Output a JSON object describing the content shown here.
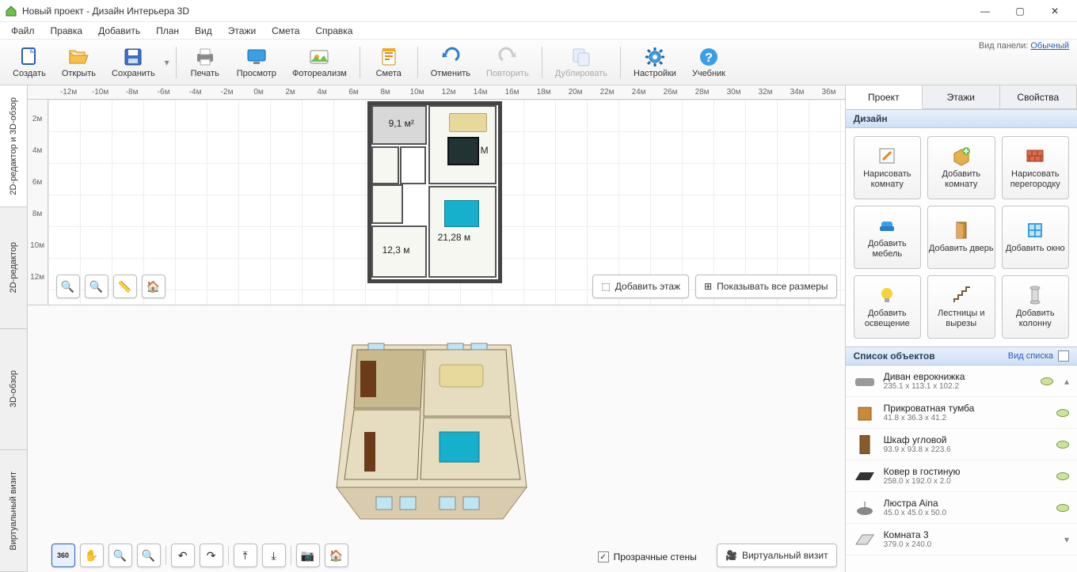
{
  "app": {
    "title": "Новый проект - Дизайн Интерьера 3D"
  },
  "window_controls": {
    "min": "—",
    "max": "▢",
    "close": "✕"
  },
  "menubar": [
    "Файл",
    "Правка",
    "Добавить",
    "План",
    "Вид",
    "Этажи",
    "Смета",
    "Справка"
  ],
  "toolbar": {
    "create": "Создать",
    "open": "Открыть",
    "save": "Сохранить",
    "print": "Печать",
    "preview": "Просмотр",
    "photoreal": "Фотореализм",
    "estimate": "Смета",
    "undo": "Отменить",
    "redo": "Повторить",
    "duplicate": "Дублировать",
    "settings": "Настройки",
    "tutorial": "Учебник"
  },
  "panel_mode": {
    "label": "Вид панели:",
    "value": "Обычный"
  },
  "left_tabs": {
    "combo": "2D-редактор и 3D-обзор",
    "editor2d": "2D-редактор",
    "view3d": "3D-обзор",
    "vr": "Виртуальный визит"
  },
  "ruler_h": [
    "-12м",
    "-10м",
    "-8м",
    "-6м",
    "-4м",
    "-2м",
    "0м",
    "2м",
    "4м",
    "6м",
    "8м",
    "10м",
    "12м",
    "14м",
    "16м",
    "18м",
    "20м",
    "22м",
    "24м",
    "26м",
    "28м",
    "30м",
    "32м",
    "34м",
    "36м"
  ],
  "ruler_v": [
    "2м",
    "4м",
    "6м",
    "8м",
    "10м",
    "12м"
  ],
  "plan": {
    "room_a": "9,1 м²",
    "room_b": "12,3 м",
    "room_c": "21,28 м",
    "mark_m": "М"
  },
  "btns2d": {
    "add_floor": "Добавить этаж",
    "show_dims": "Показывать все размеры"
  },
  "btns3d": {
    "transparent": "Прозрачные стены",
    "vr": "Виртуальный визит"
  },
  "right_tabs": {
    "project": "Проект",
    "floors": "Этажи",
    "props": "Свойства"
  },
  "design": {
    "header": "Дизайн",
    "draw_room": "Нарисовать комнату",
    "add_room": "Добавить комнату",
    "draw_wall": "Нарисовать перегородку",
    "add_furn": "Добавить мебель",
    "add_door": "Добавить дверь",
    "add_window": "Добавить окно",
    "add_light": "Добавить освещение",
    "stairs": "Лестницы и вырезы",
    "add_column": "Добавить колонну"
  },
  "objects": {
    "header": "Список объектов",
    "view_mode": "Вид списка",
    "items": [
      {
        "name": "Диван еврокнижка",
        "dims": "235.1 x 113.1 x 102.2"
      },
      {
        "name": "Прикроватная тумба",
        "dims": "41.8 x 36.3 x 41.2"
      },
      {
        "name": "Шкаф угловой",
        "dims": "93.9 x 93.8 x 223.6"
      },
      {
        "name": "Ковер в гостиную",
        "dims": "258.0 x 192.0 x 2.0"
      },
      {
        "name": "Люстра Aina",
        "dims": "45.0 x 45.0 x 50.0"
      },
      {
        "name": "Комната 3",
        "dims": "379.0 x 240.0"
      }
    ]
  },
  "colors": {
    "accent": "#2a5db0",
    "section": "#cfe0f5"
  }
}
